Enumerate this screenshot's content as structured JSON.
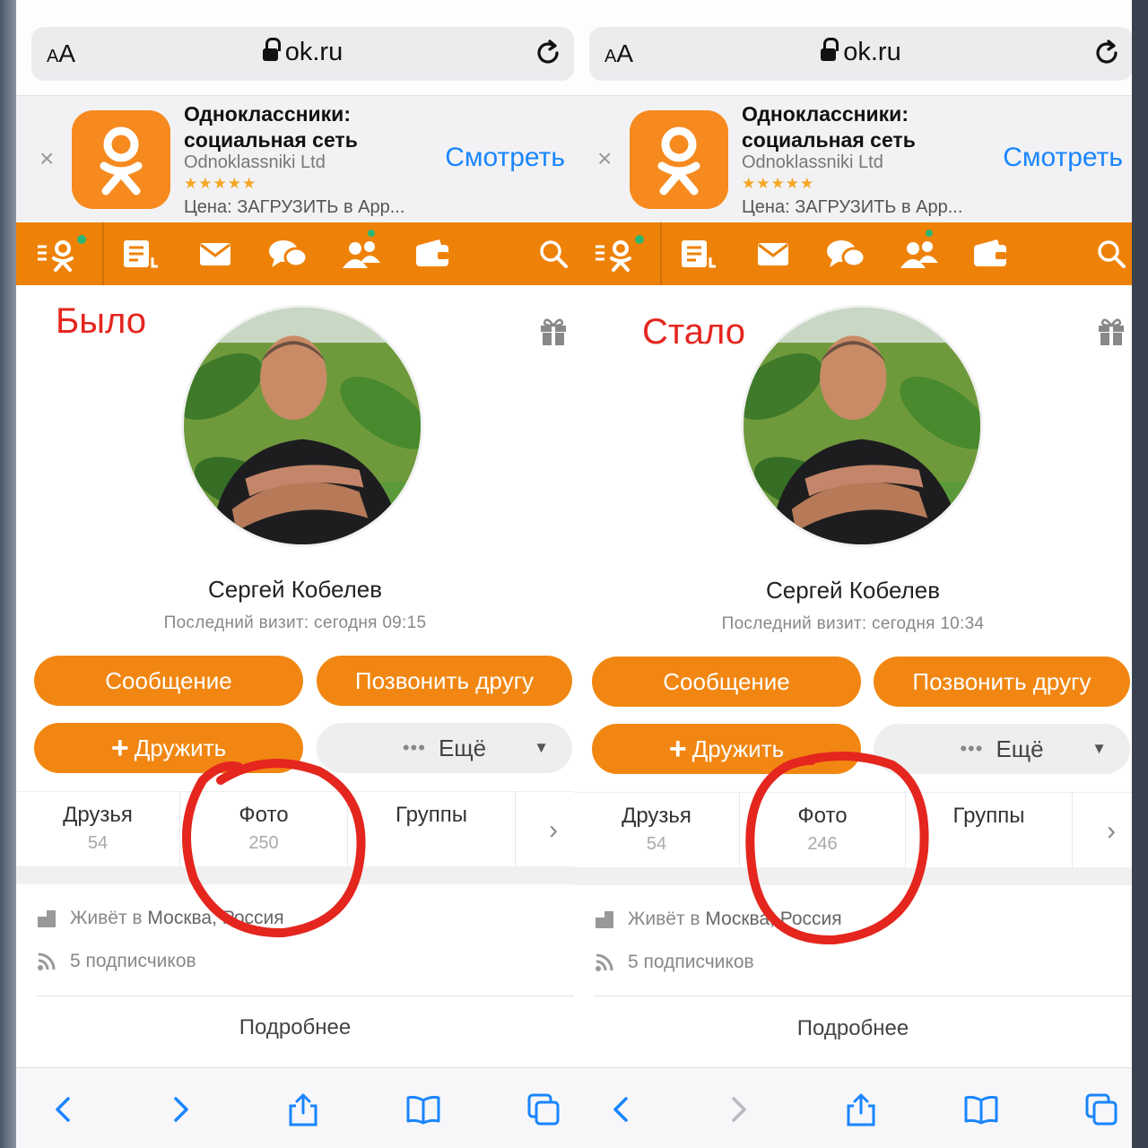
{
  "panels": [
    {
      "label": "Было",
      "browser": {
        "aa_small": "A",
        "aa_big": "A",
        "url": "ok.ru"
      },
      "banner": {
        "close": "×",
        "title": "Одноклассники: социальная сеть",
        "developer": "Odnoklassniki Ltd",
        "stars": "★★★★★",
        "price": "Цена: ЗАГРУЗИТЬ в App...",
        "action": "Смотреть"
      },
      "profile": {
        "name": "Сергей Кобелев",
        "last_visit": "Последний визит: сегодня 09:15",
        "buttons": {
          "message": "Сообщение",
          "call": "Позвонить другу",
          "add_friend": "Дружить",
          "plus": "+",
          "more": "Ещё",
          "more_dots": "•••",
          "more_arrow": "▼"
        }
      },
      "tabs": [
        {
          "label": "Друзья",
          "count": "54"
        },
        {
          "label": "Фото",
          "count": "250"
        },
        {
          "label": "Группы",
          "count": ""
        }
      ],
      "tab_arrow": "›",
      "info": {
        "lives_prefix": "Живёт в ",
        "lives_city": "Москва, Россия",
        "subscribers": "5 подписчиков"
      },
      "details_link": "Подробнее"
    },
    {
      "label": "Стало",
      "browser": {
        "aa_small": "A",
        "aa_big": "A",
        "url": "ok.ru"
      },
      "banner": {
        "close": "×",
        "title": "Одноклассники: социальная сеть",
        "developer": "Odnoklassniki Ltd",
        "stars": "★★★★★",
        "price": "Цена: ЗАГРУЗИТЬ в App...",
        "action": "Смотреть"
      },
      "profile": {
        "name": "Сергей Кобелев",
        "last_visit": "Последний визит: сегодня 10:34",
        "buttons": {
          "message": "Сообщение",
          "call": "Позвонить другу",
          "add_friend": "Дружить",
          "plus": "+",
          "more": "Ещё",
          "more_dots": "•••",
          "more_arrow": "▼"
        }
      },
      "tabs": [
        {
          "label": "Друзья",
          "count": "54"
        },
        {
          "label": "Фото",
          "count": "246"
        },
        {
          "label": "Группы",
          "count": ""
        }
      ],
      "tab_arrow": "›",
      "info": {
        "lives_prefix": "Живёт в ",
        "lives_city": "Москва, Россия",
        "subscribers": "5 подписчиков"
      },
      "details_link": "Подробнее"
    }
  ],
  "colors": {
    "ok_orange": "#ee8208",
    "annotation_red": "#e4261e",
    "safari_blue": "#1a85ff",
    "online_dot": "#2bb673"
  },
  "icons": [
    "lock-icon",
    "reload-icon",
    "ok-logo-icon",
    "menu-icon",
    "feed-icon",
    "mail-icon",
    "chat-icon",
    "friends-icon",
    "wallet-icon",
    "search-icon",
    "gift-icon",
    "house-icon",
    "rss-icon",
    "back-icon",
    "forward-icon",
    "share-icon",
    "bookmarks-icon",
    "tabs-icon"
  ]
}
